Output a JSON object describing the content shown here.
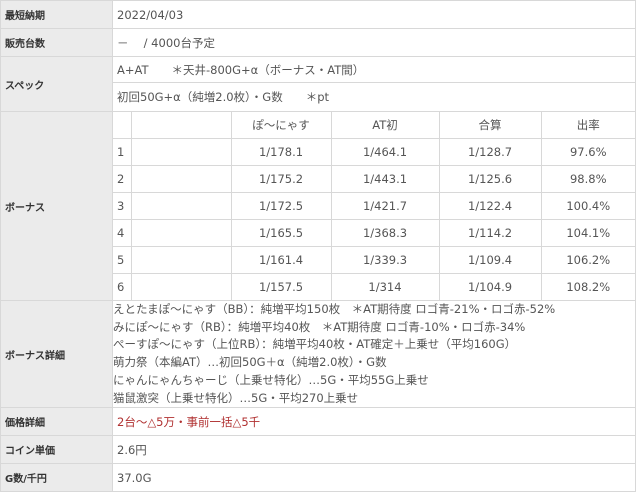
{
  "rows": {
    "release": {
      "label": "最短納期",
      "value": "2022/04/03"
    },
    "units": {
      "label": "販売台数",
      "value": "－　 / 4000台予定"
    },
    "spec": {
      "label": "スペック",
      "line1": "A+AT　　＊天井-800G+α（ボーナス・AT間）",
      "line2": "初回50G+α（純増2.0枚）・G数　　＊pt"
    },
    "bonus": {
      "label": "ボーナス",
      "headers": [
        "",
        "",
        "ぽ～にゃす",
        "AT初",
        "合算",
        "出率"
      ],
      "data": [
        [
          "1",
          "",
          "1/178.1",
          "1/464.1",
          "1/128.7",
          "97.6%"
        ],
        [
          "2",
          "",
          "1/175.2",
          "1/443.1",
          "1/125.6",
          "98.8%"
        ],
        [
          "3",
          "",
          "1/172.5",
          "1/421.7",
          "1/122.4",
          "100.4%"
        ],
        [
          "4",
          "",
          "1/165.5",
          "1/368.3",
          "1/114.2",
          "104.1%"
        ],
        [
          "5",
          "",
          "1/161.4",
          "1/339.3",
          "1/109.4",
          "106.2%"
        ],
        [
          "6",
          "",
          "1/157.5",
          "1/314",
          "1/104.9",
          "108.2%"
        ]
      ]
    },
    "bonus_detail": {
      "label": "ボーナス詳細",
      "lines": [
        "えとたまぽ～にゃす（BB）：純増平均150枚　＊AT期待度 ロゴ青-21%・ロゴ赤-52%",
        "みにぽ～にゃす（RB）：純増平均40枚　＊AT期待度 ロゴ青-10%・ロゴ赤-34%",
        "ぺーすぽ～にゃす（上位RB）：純増平均40枚・AT確定＋上乗せ（平均160G）",
        "萌力祭（本編AT）…初回50G＋α（純増2.0枚）・G数",
        "にゃんにゃんちゃーじ（上乗せ特化）…5G・平均55G上乗せ",
        "猫鼠激突（上乗せ特化）…5G・平均270上乗せ"
      ]
    },
    "price": {
      "label": "価格詳細",
      "value": "2台～△5万・事前一括△5千",
      "color": "#b03030"
    },
    "coin": {
      "label": "コイン単価",
      "value": "2.6円"
    },
    "g_per_1000": {
      "label": "G数/千円",
      "value": "37.0G"
    }
  }
}
